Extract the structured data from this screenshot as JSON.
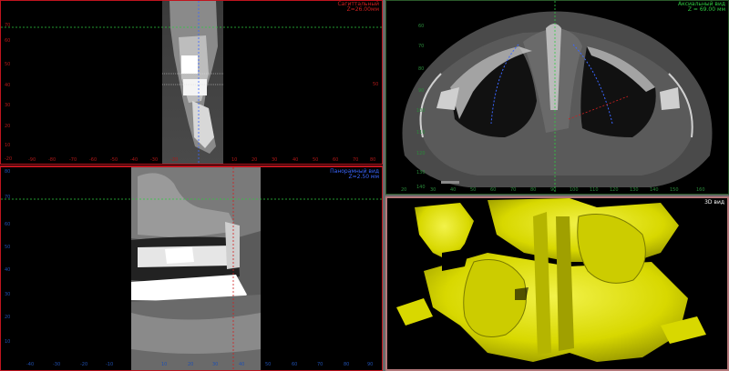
{
  "colors": {
    "sagittal_border": "#c0141e",
    "panoramic_border": "#c0141e",
    "axial_border": "#2a5a2a",
    "render_border": "#b4787a",
    "cursor_green": "#2ecc40",
    "cursor_red": "#d02020",
    "cursor_blue": "#3a66ff",
    "render_yellow": "#e6e600"
  },
  "sagittal": {
    "title": "Сагиттальный",
    "position": "Z=26.00мм",
    "left_ticks": [
      "70",
      "60",
      "50",
      "40",
      "30",
      "20",
      "10",
      "-20"
    ],
    "bottom_ticks": [
      "-90",
      "-80",
      "-70",
      "-60",
      "-50",
      "-40",
      "-30",
      "-20",
      "10",
      "20",
      "30",
      "40",
      "50",
      "60",
      "70",
      "80"
    ]
  },
  "panoramic": {
    "title": "Панорамный вид",
    "position": "Z=2.50 мм",
    "left_ticks": [
      "80",
      "70",
      "60",
      "50",
      "40",
      "30",
      "20",
      "10"
    ],
    "bottom_ticks": [
      "-40",
      "-30",
      "-20",
      "-10",
      "10",
      "20",
      "30",
      "40",
      "50",
      "60",
      "70",
      "80",
      "90"
    ]
  },
  "axial": {
    "title": "Аксиальный вид",
    "position": "Z = 69.00 мм",
    "left_ticks": [
      "60",
      "70",
      "80",
      "90",
      "100",
      "110",
      "120",
      "130",
      "140"
    ],
    "bottom_ticks": [
      "20",
      "30",
      "40",
      "50",
      "60",
      "70",
      "80",
      "90",
      "100",
      "110",
      "120",
      "130",
      "140",
      "150",
      "160"
    ]
  },
  "render3d": {
    "title": "3D вид"
  },
  "icons": [
    "crosshair-cursor-icon"
  ]
}
